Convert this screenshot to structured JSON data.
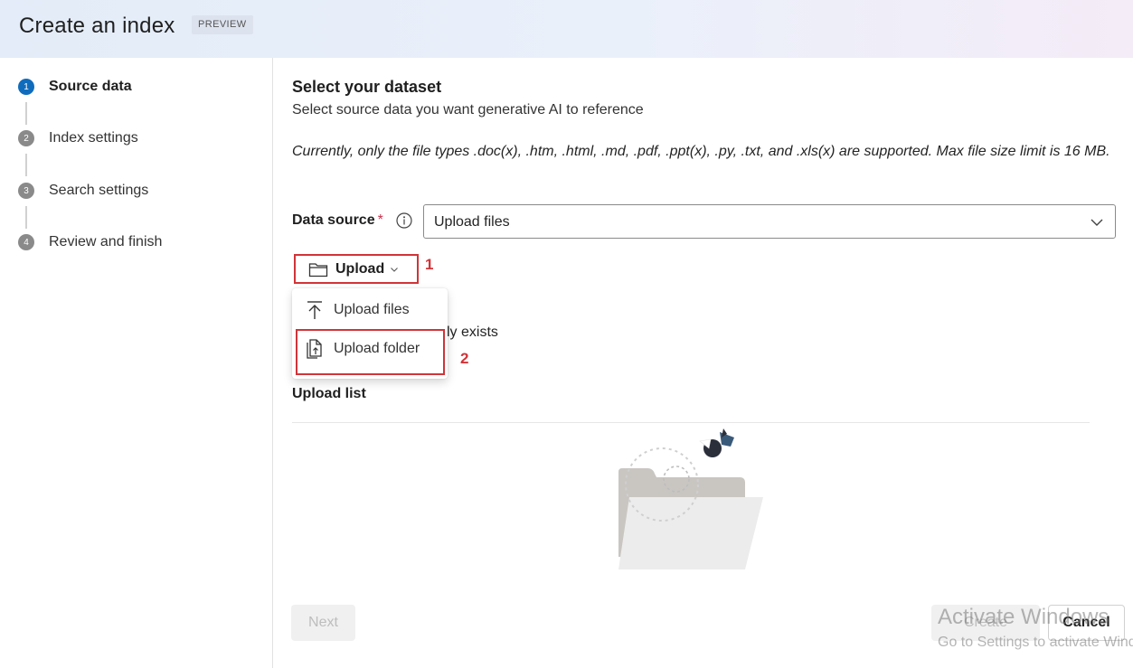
{
  "header": {
    "title": "Create an index",
    "badge": "PREVIEW"
  },
  "steps": [
    {
      "num": "1",
      "label": "Source data",
      "active": true
    },
    {
      "num": "2",
      "label": "Index settings",
      "active": false
    },
    {
      "num": "3",
      "label": "Search settings",
      "active": false
    },
    {
      "num": "4",
      "label": "Review and finish",
      "active": false
    }
  ],
  "main": {
    "title": "Select your dataset",
    "subtitle": "Select source data you want generative AI to reference",
    "note": "Currently, only the file types .doc(x), .htm, .html, .md, .pdf, .ppt(x), .py, .txt, and .xls(x) are supported. Max file size limit is 16 MB.",
    "data_source": {
      "label": "Data source",
      "required_mark": "*",
      "value": "Upload files"
    },
    "upload_button": {
      "label": "Upload"
    },
    "upload_menu": [
      {
        "label": "Upload files",
        "icon": "upload-arrow-icon"
      },
      {
        "label": "Upload folder",
        "icon": "upload-folder-icon"
      }
    ],
    "partially_hidden_text": "ly exists",
    "upload_list_title": "Upload list"
  },
  "annotations": {
    "first": "1",
    "second": "2"
  },
  "footer": {
    "next_label": "Next",
    "create_label": "Create",
    "cancel_label": "Cancel"
  },
  "watermark": {
    "line1": "Activate Windows",
    "line2": "Go to Settings to activate Windows."
  },
  "colors": {
    "accent": "#0f6cbd",
    "highlight": "#d13438",
    "required": "#c4314b"
  }
}
